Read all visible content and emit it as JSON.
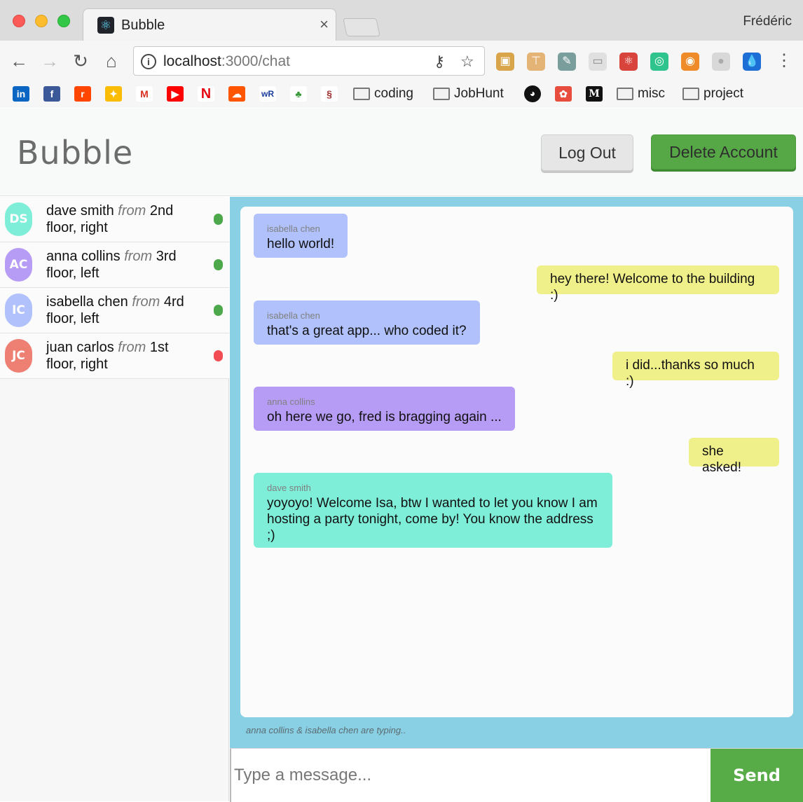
{
  "browser": {
    "tab_title": "Bubble",
    "tab_close": "×",
    "profile_name": "Frédéric",
    "url_host": "localhost",
    "url_path": ":3000/chat",
    "nav": {
      "back": "←",
      "forward": "→",
      "reload": "↻",
      "home": "⌂"
    },
    "bookmarks": {
      "linkedin": "in",
      "facebook": "f",
      "reddit": "r",
      "gmail": "M",
      "youtube": "▶",
      "netflix": "N",
      "soundcloud": "☁",
      "wr": "wR",
      "medium": "M",
      "coding": "coding",
      "jobhunt": "JobHunt",
      "misc": "misc",
      "project": "project"
    }
  },
  "app": {
    "brand": "Bubble",
    "logout_label": "Log Out",
    "delete_label": "Delete Account",
    "users": [
      {
        "initials": "DS",
        "name": "dave smith",
        "from": "from",
        "location": "2nd floor, right",
        "avatar_color": "#7eeed8",
        "status_color": "#4ca84a"
      },
      {
        "initials": "AC",
        "name": "anna collins",
        "from": "from",
        "location": "3rd floor, left",
        "avatar_color": "#b79cf6",
        "status_color": "#4ca84a"
      },
      {
        "initials": "IC",
        "name": "isabella chen",
        "from": "from",
        "location": "4rd floor, left",
        "avatar_color": "#b0c1fc",
        "status_color": "#4ca84a"
      },
      {
        "initials": "JC",
        "name": "juan carlos",
        "from": "from",
        "location": "1st floor, right",
        "avatar_color": "#ee8073",
        "status_color": "#f24c55"
      }
    ],
    "messages": [
      {
        "side": "left",
        "sender": "isabella chen",
        "text": "hello world!",
        "color": "#b0c1fc"
      },
      {
        "side": "right",
        "sender": "",
        "text": "hey there! Welcome to the building :)",
        "color": "#f0f08a"
      },
      {
        "side": "left",
        "sender": "isabella chen",
        "text": "that's a great app... who coded it?",
        "color": "#b0c1fc"
      },
      {
        "side": "right",
        "sender": "",
        "text": "i did...thanks so much :)",
        "color": "#f0f08a"
      },
      {
        "side": "left",
        "sender": "anna collins",
        "text": "oh here we go, fred is bragging again ...",
        "color": "#b79cf6"
      },
      {
        "side": "right",
        "sender": "",
        "text": "she asked!",
        "color": "#f0f08a"
      },
      {
        "side": "left",
        "sender": "dave smith",
        "text": "yoyoyo! Welcome Isa, btw I wanted to let you know I am hosting a party tonight, come by! You know the address ;)",
        "color": "#7eeed8"
      }
    ],
    "typing_indicator": "anna collins & isabella chen are typing..",
    "input_placeholder": "Type a message...",
    "input_value": "",
    "send_label": "Send",
    "chat_bg_color": "#89d0e4",
    "accent_green": "#56a846"
  }
}
